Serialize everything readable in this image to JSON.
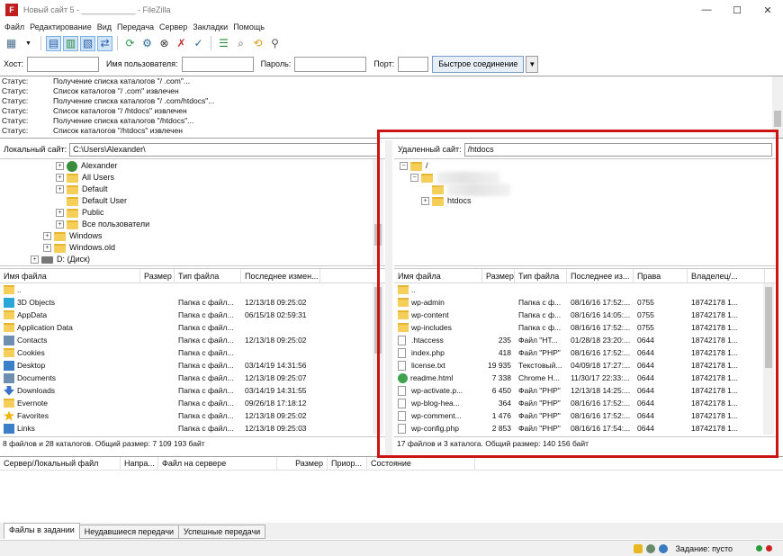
{
  "window": {
    "title": "Новый сайт 5 - ____________ - FileZilla",
    "logo_letter": "F",
    "controls": [
      "—",
      "☐",
      "✕"
    ]
  },
  "menu": [
    "Файл",
    "Редактирование",
    "Вид",
    "Передача",
    "Сервер",
    "Закладки",
    "Помощь"
  ],
  "toolbar_icons": [
    "site-manager-icon",
    "toggle-log-icon",
    "toggle-local-tree-icon",
    "toggle-remote-tree-icon",
    "toggle-queue-icon",
    "refresh-icon",
    "process-queue-icon",
    "cancel-icon",
    "disconnect-icon",
    "reconnect-icon",
    "filter-icon",
    "toggle-sync-icon",
    "search-icon",
    "compare-icon"
  ],
  "quickconnect": {
    "host_label": "Хост:",
    "user_label": "Имя пользователя:",
    "pass_label": "Пароль:",
    "port_label": "Порт:",
    "button": "Быстрое соединение",
    "host_value": "",
    "user_value": "",
    "pass_value": "",
    "port_value": ""
  },
  "log": [
    {
      "status": "Статус:",
      "msg": "Получение списка каталогов \"/            .com\"..."
    },
    {
      "status": "Статус:",
      "msg": "Список каталогов \"/            .com\" извлечен"
    },
    {
      "status": "Статус:",
      "msg": "Получение списка каталогов \"/             .com/htdocs\"..."
    },
    {
      "status": "Статус:",
      "msg": "Список каталогов \"/            /htdocs\" извлечен"
    },
    {
      "status": "Статус:",
      "msg": "Получение списка каталогов \"/htdocs\"..."
    },
    {
      "status": "Статус:",
      "msg": "Список каталогов \"/htdocs\" извлечен"
    }
  ],
  "local": {
    "path_label": "Локальный сайт:",
    "path": "C:\\Users\\Alexander\\",
    "tree": [
      {
        "label": "Alexander",
        "icon": "user",
        "exp": "+",
        "indent": 1
      },
      {
        "label": "All Users",
        "icon": "folder",
        "exp": "+",
        "indent": 1
      },
      {
        "label": "Default",
        "icon": "folder",
        "exp": "+",
        "indent": 1
      },
      {
        "label": "Default User",
        "icon": "folder",
        "exp": "",
        "indent": 1
      },
      {
        "label": "Public",
        "icon": "folder",
        "exp": "+",
        "indent": 1
      },
      {
        "label": "Все пользователи",
        "icon": "folder",
        "exp": "+",
        "indent": 1
      },
      {
        "label": "Windows",
        "icon": "folder",
        "exp": "+",
        "indent": 0
      },
      {
        "label": "Windows.old",
        "icon": "folder",
        "exp": "+",
        "indent": 0
      },
      {
        "label": "D: (Диск)",
        "icon": "drive",
        "exp": "+",
        "indent": -1
      }
    ],
    "columns": [
      "Имя файла",
      "Размер",
      "Тип файла",
      "Последнее измен..."
    ],
    "files": [
      {
        "name": "..",
        "size": "",
        "type": "",
        "modified": "",
        "icon": "folder-i"
      },
      {
        "name": "3D Objects",
        "size": "",
        "type": "Папка с файл...",
        "modified": "12/13/18 09:25:02",
        "icon": "cyan-i"
      },
      {
        "name": "AppData",
        "size": "",
        "type": "Папка с файл...",
        "modified": "06/15/18 02:59:31",
        "icon": "folder-i"
      },
      {
        "name": "Application Data",
        "size": "",
        "type": "Папка с файл...",
        "modified": "",
        "icon": "folder-i"
      },
      {
        "name": "Contacts",
        "size": "",
        "type": "Папка с файл...",
        "modified": "12/13/18 09:25:02",
        "icon": "grey-i"
      },
      {
        "name": "Cookies",
        "size": "",
        "type": "Папка с файл...",
        "modified": "",
        "icon": "folder-i"
      },
      {
        "name": "Desktop",
        "size": "",
        "type": "Папка с файл...",
        "modified": "03/14/19 14:31:56",
        "icon": "blue-i"
      },
      {
        "name": "Documents",
        "size": "",
        "type": "Папка с файл...",
        "modified": "12/13/18 09:25:07",
        "icon": "grey-i"
      },
      {
        "name": "Downloads",
        "size": "",
        "type": "Папка с файл...",
        "modified": "03/14/19 14:31:55",
        "icon": "arrow-i"
      },
      {
        "name": "Evernote",
        "size": "",
        "type": "Папка с файл...",
        "modified": "09/26/18 17:18:12",
        "icon": "folder-i"
      },
      {
        "name": "Favorites",
        "size": "",
        "type": "Папка с файл...",
        "modified": "12/13/18 09:25:02",
        "icon": "star-i"
      },
      {
        "name": "Links",
        "size": "",
        "type": "Папка с файл...",
        "modified": "12/13/18 09:25:03",
        "icon": "blue-i"
      }
    ],
    "summary": "8 файлов и 28 каталогов. Общий размер: 7 109 193 байт"
  },
  "remote": {
    "path_label": "Удаленный сайт:",
    "path": "/htdocs",
    "tree": [
      {
        "label": "/",
        "exp": "−",
        "indent": 0
      },
      {
        "label": "",
        "exp": "−",
        "indent": 1,
        "blur": true
      },
      {
        "label": "",
        "exp": "",
        "indent": 2,
        "blur": true
      },
      {
        "label": "htdocs",
        "exp": "+",
        "indent": 2
      }
    ],
    "columns": [
      "Имя файла",
      "Размер",
      "Тип файла",
      "Последнее из...",
      "Права",
      "Владелец/..."
    ],
    "files": [
      {
        "name": "..",
        "size": "",
        "type": "",
        "modified": "",
        "perm": "",
        "owner": "",
        "icon": "folder-i"
      },
      {
        "name": "wp-admin",
        "size": "",
        "type": "Папка с ф...",
        "modified": "08/16/16 17:52:...",
        "perm": "0755",
        "owner": "18742178 1...",
        "icon": "folder-i"
      },
      {
        "name": "wp-content",
        "size": "",
        "type": "Папка с ф...",
        "modified": "08/16/16 14:05:...",
        "perm": "0755",
        "owner": "18742178 1...",
        "icon": "folder-i"
      },
      {
        "name": "wp-includes",
        "size": "",
        "type": "Папка с ф...",
        "modified": "08/16/16 17:52:...",
        "perm": "0755",
        "owner": "18742178 1...",
        "icon": "folder-i"
      },
      {
        "name": ".htaccess",
        "size": "235",
        "type": "Файл \"HT...",
        "modified": "01/28/18 23:20:...",
        "perm": "0644",
        "owner": "18742178 1...",
        "icon": "file-i"
      },
      {
        "name": "index.php",
        "size": "418",
        "type": "Файл \"PHP\"",
        "modified": "08/16/16 17:52:...",
        "perm": "0644",
        "owner": "18742178 1...",
        "icon": "file-i"
      },
      {
        "name": "license.txt",
        "size": "19 935",
        "type": "Текстовый...",
        "modified": "04/09/18 17:27:...",
        "perm": "0644",
        "owner": "18742178 1...",
        "icon": "file-i"
      },
      {
        "name": "readme.html",
        "size": "7 338",
        "type": "Chrome H...",
        "modified": "11/30/17 22:33:...",
        "perm": "0644",
        "owner": "18742178 1...",
        "icon": "html-i"
      },
      {
        "name": "wp-activate.p...",
        "size": "6 450",
        "type": "Файл \"PHP\"",
        "modified": "12/13/18 14:25:...",
        "perm": "0644",
        "owner": "18742178 1...",
        "icon": "file-i"
      },
      {
        "name": "wp-blog-hea...",
        "size": "364",
        "type": "Файл \"PHP\"",
        "modified": "08/16/16 17:52:...",
        "perm": "0644",
        "owner": "18742178 1...",
        "icon": "file-i"
      },
      {
        "name": "wp-comment...",
        "size": "1 476",
        "type": "Файл \"PHP\"",
        "modified": "08/16/16 17:52:...",
        "perm": "0644",
        "owner": "18742178 1...",
        "icon": "file-i"
      },
      {
        "name": "wp-config.php",
        "size": "2 853",
        "type": "Файл \"PHP\"",
        "modified": "08/16/16 17:54:...",
        "perm": "0644",
        "owner": "18742178 1...",
        "icon": "file-i"
      }
    ],
    "summary": "17 файлов и 3 каталога. Общий размер: 140 156 байт"
  },
  "queue": {
    "columns": [
      "Сервер/Локальный файл",
      "Напра...",
      "Файл на сервере",
      "Размер",
      "Приор...",
      "Состояние"
    ],
    "tabs": [
      "Файлы в задании",
      "Неудавшиеся передачи",
      "Успешные передачи"
    ]
  },
  "statusbar": {
    "task_label": "Задание: пусто"
  },
  "colors": {
    "highlight": "#cc1414",
    "folder": "#f5cf5a",
    "accent": "#7ab0e3"
  }
}
